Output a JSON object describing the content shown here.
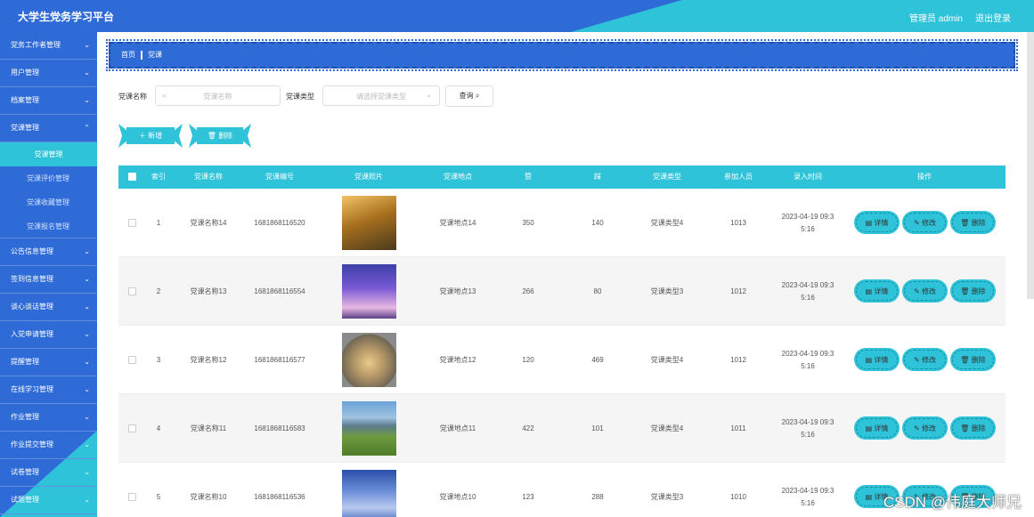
{
  "header": {
    "title": "大学生党务学习平台",
    "user": "管理员 admin",
    "logout": "退出登录"
  },
  "sidebar": {
    "items": [
      {
        "label": "党务工作者管理"
      },
      {
        "label": "用户管理"
      },
      {
        "label": "档案管理"
      },
      {
        "label": "党课管理"
      }
    ],
    "sub_items": [
      {
        "label": "党课管理"
      },
      {
        "label": "党课评价管理"
      },
      {
        "label": "党课收藏管理"
      },
      {
        "label": "党课报名管理"
      }
    ],
    "items_after": [
      {
        "label": "公告信息管理"
      },
      {
        "label": "签到信息管理"
      },
      {
        "label": "谈心谈话管理"
      },
      {
        "label": "入党申请管理"
      },
      {
        "label": "提醒管理"
      },
      {
        "label": "在线学习管理"
      },
      {
        "label": "作业管理"
      },
      {
        "label": "作业提交管理"
      },
      {
        "label": "试卷管理"
      },
      {
        "label": "试题管理"
      }
    ]
  },
  "breadcrumb": {
    "home": "首页",
    "current": "党课"
  },
  "search": {
    "name_label": "党课名称",
    "name_placeholder": "党课名称",
    "type_label": "党课类型",
    "type_placeholder": "请选择党课类型",
    "query_label": "查询"
  },
  "actions": {
    "add_label": "新增",
    "delete_label": "删除"
  },
  "table": {
    "columns": [
      "索引",
      "党课名称",
      "党课编号",
      "党课照片",
      "党课地点",
      "赞",
      "踩",
      "党课类型",
      "参加人员",
      "录入时间",
      "操作"
    ],
    "op_labels": {
      "detail": "详情",
      "edit": "修改",
      "delete": "删除"
    },
    "rows": [
      {
        "index": "1",
        "name": "党课名称14",
        "code": "1681868116520",
        "place": "党课地点14",
        "like": "350",
        "dislike": "140",
        "type": "党课类型4",
        "people": "1013",
        "time1": "2023-04-19 09:3",
        "time2": "5:16"
      },
      {
        "index": "2",
        "name": "党课名称13",
        "code": "1681868116554",
        "place": "党课地点13",
        "like": "266",
        "dislike": "80",
        "type": "党课类型3",
        "people": "1012",
        "time1": "2023-04-19 09:3",
        "time2": "5:16"
      },
      {
        "index": "3",
        "name": "党课名称12",
        "code": "1681868116577",
        "place": "党课地点12",
        "like": "120",
        "dislike": "469",
        "type": "党课类型4",
        "people": "1012",
        "time1": "2023-04-19 09:3",
        "time2": "5:16"
      },
      {
        "index": "4",
        "name": "党课名称11",
        "code": "1681868116583",
        "place": "党课地点11",
        "like": "422",
        "dislike": "101",
        "type": "党课类型4",
        "people": "1011",
        "time1": "2023-04-19 09:3",
        "time2": "5:16"
      },
      {
        "index": "5",
        "name": "党课名称10",
        "code": "1681868116536",
        "place": "党课地点10",
        "like": "123",
        "dislike": "288",
        "type": "党课类型3",
        "people": "1010",
        "time1": "2023-04-19 09:3",
        "time2": "5:16"
      }
    ]
  },
  "watermark": "CSDN @伟庭大师兄"
}
